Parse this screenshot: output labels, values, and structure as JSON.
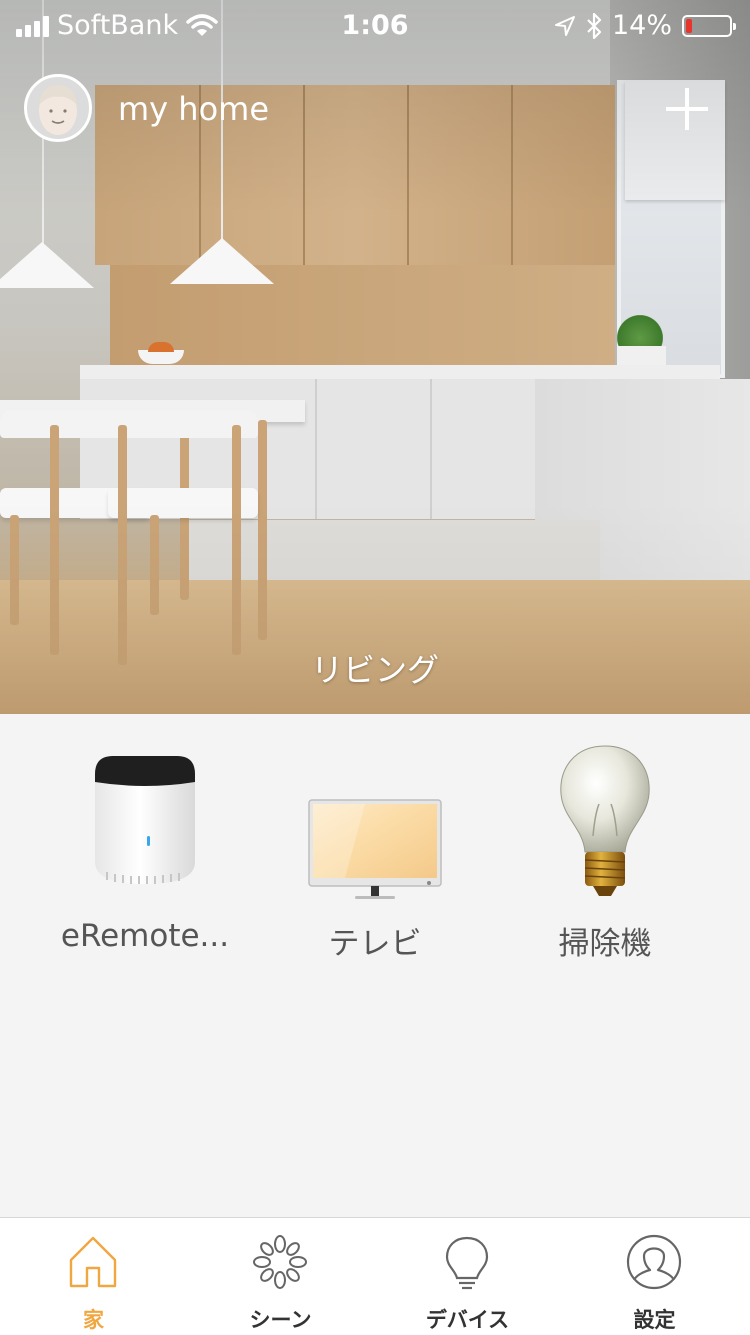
{
  "status_bar": {
    "carrier": "SoftBank",
    "time": "1:06",
    "battery_percent": "14%",
    "battery_level": 0.14,
    "icons": [
      "signal-icon",
      "wifi-icon",
      "location-icon",
      "bluetooth-icon",
      "battery-icon"
    ]
  },
  "header": {
    "home_name": "my home",
    "add_icon": "plus-icon"
  },
  "room": {
    "name": "リビング"
  },
  "devices": [
    {
      "label": "eRemote...",
      "icon": "remote-hub-icon"
    },
    {
      "label": "テレビ",
      "icon": "tv-icon"
    },
    {
      "label": "掃除機",
      "icon": "lightbulb-icon"
    }
  ],
  "tabs": [
    {
      "label": "家",
      "icon": "home-icon",
      "active": true
    },
    {
      "label": "シーン",
      "icon": "scene-icon",
      "active": false
    },
    {
      "label": "デバイス",
      "icon": "device-bulb-icon",
      "active": false
    },
    {
      "label": "設定",
      "icon": "profile-icon",
      "active": false
    }
  ],
  "colors": {
    "accent": "#f0a742",
    "tab_inactive": "#333333",
    "background": "#f4f4f4"
  }
}
